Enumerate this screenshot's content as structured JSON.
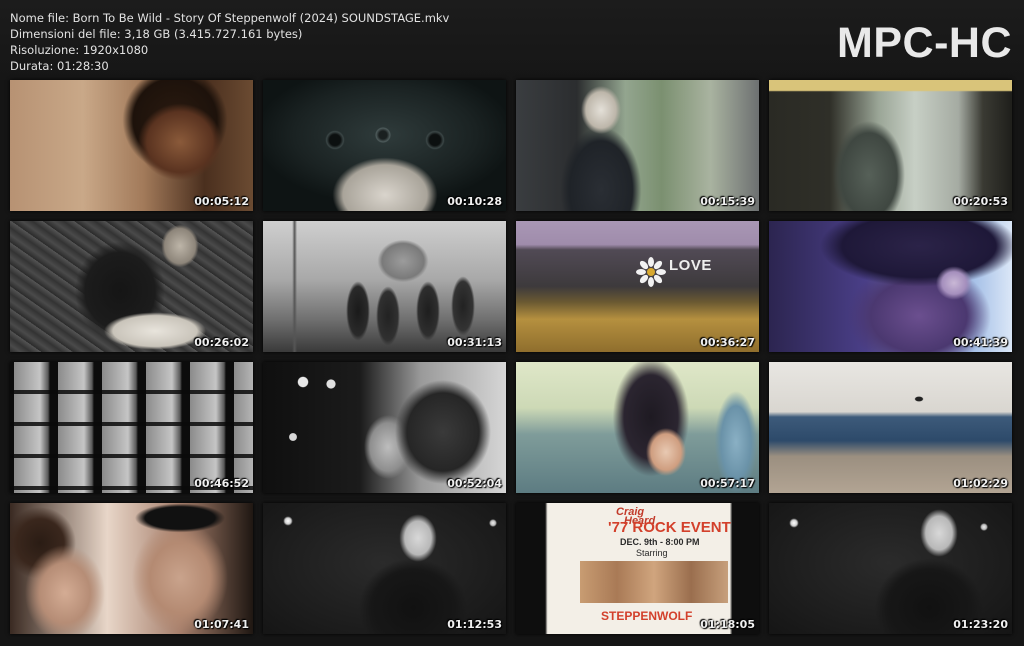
{
  "info": {
    "filename": "Nome file: Born To Be Wild - Story Of Steppenwolf (2024) SOUNDSTAGE.mkv",
    "filesize": "Dimensioni del file: 3,18 GB (3.415.727.161 bytes)",
    "resolution": "Risoluzione: 1920x1080",
    "duration": "Durata: 01:28:30"
  },
  "logo": "MPC-HC",
  "thumbnails": [
    {
      "time": "00:05:12"
    },
    {
      "time": "00:10:28"
    },
    {
      "time": "00:15:39"
    },
    {
      "time": "00:20:53"
    },
    {
      "time": "00:26:02"
    },
    {
      "time": "00:31:13"
    },
    {
      "time": "00:36:27"
    },
    {
      "time": "00:41:39"
    },
    {
      "time": "00:46:52"
    },
    {
      "time": "00:52:04"
    },
    {
      "time": "00:57:17"
    },
    {
      "time": "01:02:29"
    },
    {
      "time": "01:07:41"
    },
    {
      "time": "01:12:53"
    },
    {
      "time": "01:18:05"
    },
    {
      "time": "01:23:20"
    }
  ],
  "frame_text": {
    "love": "LOVE",
    "craig": "Craig",
    "heard": "Heard",
    "rock_event": "'77 ROCK EVENT",
    "date": "DEC. 9th - 8:00 PM",
    "starring": "Starring",
    "band": "STEPPENWOLF"
  }
}
